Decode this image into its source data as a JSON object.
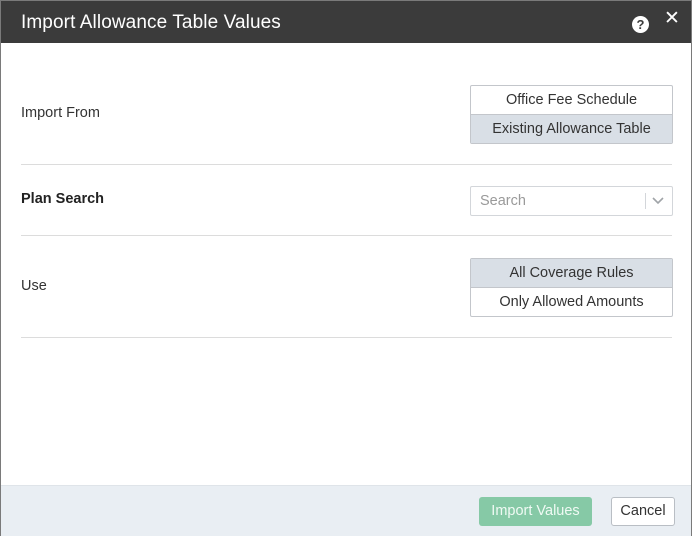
{
  "dialog": {
    "title": "Import Allowance Table Values",
    "help_icon": "help-circle-icon",
    "help_glyph": "?",
    "close_icon": "close-icon",
    "close_glyph": "✕"
  },
  "import_from": {
    "label": "Import From",
    "options": [
      {
        "label": "Office Fee Schedule",
        "selected": false
      },
      {
        "label": "Existing Allowance Table",
        "selected": true
      }
    ]
  },
  "plan_search": {
    "label": "Plan Search",
    "placeholder": "Search",
    "value": "",
    "dropdown_icon": "chevron-down-icon"
  },
  "use": {
    "label": "Use",
    "options": [
      {
        "label": "All Coverage Rules",
        "selected": true
      },
      {
        "label": "Only Allowed Amounts",
        "selected": false
      }
    ]
  },
  "footer": {
    "import_label": "Import Values",
    "cancel_label": "Cancel"
  },
  "colors": {
    "header_bg": "#3b3b3b",
    "selected_option_bg": "#d9dfe6",
    "primary_button_bg": "#86c9a6",
    "footer_bg": "#e9eef3"
  }
}
